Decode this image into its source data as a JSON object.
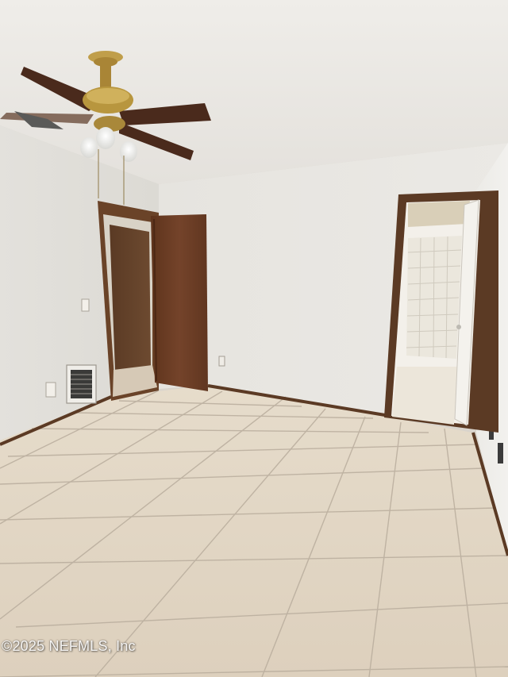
{
  "watermark": {
    "text": "©2025 NEFMLS, Inc"
  },
  "colors": {
    "ceiling": "#ece9e4",
    "wall_left": "#e6e4df",
    "wall_back": "#e9e7e2",
    "floor_tile": "#e2d6c4",
    "grout": "#b9ad9d",
    "wood_trim": "#5b3a24",
    "door_wood": "#6e3f22",
    "fan_brass": "#b8963e",
    "fan_blade": "#4a2a1c"
  },
  "scene_objects": [
    "ceiling-fan",
    "left-doorway",
    "open-wood-door",
    "light-switch",
    "hvac-vent",
    "bathroom-doorway",
    "tile-floor",
    "baseboard"
  ]
}
